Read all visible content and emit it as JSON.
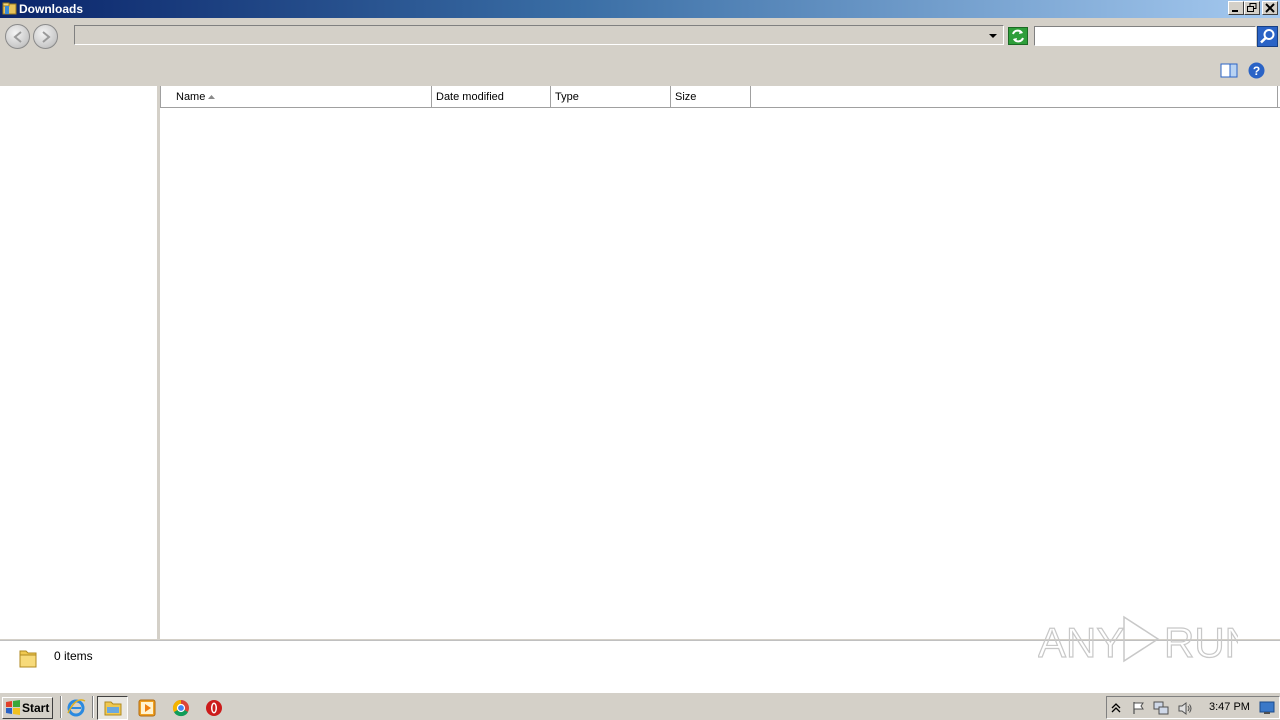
{
  "window": {
    "title": "Downloads",
    "controls": [
      "minimize-icon",
      "restore-icon",
      "close-icon"
    ]
  },
  "address": {
    "path": "",
    "search_placeholder": ""
  },
  "file_list": {
    "columns": [
      "Name",
      "Date modified",
      "Type",
      "Size"
    ],
    "sort_column": "Name",
    "sort_direction": "ascending",
    "rows": []
  },
  "status": {
    "item_count": "0 items"
  },
  "watermark": {
    "text": "ANY RUN"
  },
  "taskbar": {
    "start_label": "Start",
    "pinned": [
      "internet-explorer-icon",
      "windows-explorer-icon",
      "media-player-icon",
      "chrome-icon",
      "opera-icon"
    ],
    "tray_icons": [
      "show-hidden-icons-icon",
      "action-center-flag-icon",
      "network-icon",
      "volume-icon"
    ],
    "clock": "3:47 PM"
  },
  "colors": {
    "titlebar_start": "#0a246a",
    "titlebar_end": "#a6caf0",
    "chrome": "#d4d0c8",
    "refresh_green": "#2e9e3a",
    "search_blue": "#2a63c6"
  }
}
